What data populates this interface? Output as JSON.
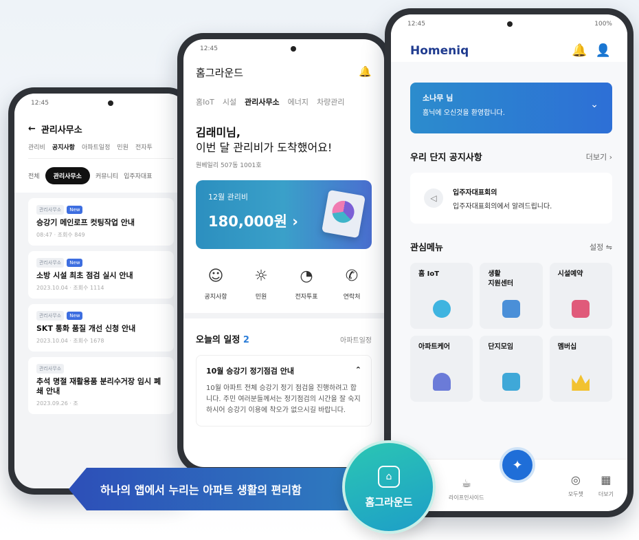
{
  "phone1": {
    "time": "12:45",
    "signal": "",
    "back_icon": "←",
    "title": "관리사무소",
    "tabs": [
      "관리비",
      "공지사항",
      "아파트일정",
      "민원",
      "전자투"
    ],
    "chips": [
      "전체",
      "관리사무소",
      "커뮤니티",
      "입주자대표"
    ],
    "cards": [
      {
        "tag": "관리사무소",
        "new": "New",
        "title": "승강기 메인로프 컷팅작업 안내",
        "meta": "08:47 · 조회수 849"
      },
      {
        "tag": "관리사무소",
        "new": "New",
        "title": "소방 시설 최초 점검 실시 안내",
        "meta": "2023.10.04 · 조회수 1114"
      },
      {
        "tag": "관리사무소",
        "new": "New",
        "title": "SKT 통화 품질 개선 신청 안내",
        "meta": "2023.10.04 · 조회수 1678"
      },
      {
        "tag": "관리사무소",
        "new": "",
        "title": "추석 명절 재활용품 분리수거장 임시 폐쇄 안내",
        "meta": "2023.09.26 · 조"
      }
    ]
  },
  "phone2": {
    "time": "12:45",
    "signal": "",
    "brand": "홈그라운드",
    "tabs": [
      "홈IoT",
      "시설",
      "관리사무소",
      "에너지",
      "차량관리"
    ],
    "greeting_name": "김래미님,",
    "greeting_msg": "이번 달 관리비가 도착했어요!",
    "address": "원베일리 507동 1001호",
    "bill_month": "12월 관리비",
    "bill_amount": "180,000원 ›",
    "quick": [
      {
        "icon": "☺",
        "label": "공지사항"
      },
      {
        "icon": "☼",
        "label": "민원"
      },
      {
        "icon": "◔",
        "label": "전자투표"
      },
      {
        "icon": "✆",
        "label": "연락처"
      }
    ],
    "schedule_title": "오늘의 일정",
    "schedule_count": "2",
    "schedule_link": "아파트일정",
    "schedule_card_title": "10월 승강기 정기점검 안내",
    "schedule_card_chevron": "⌃",
    "schedule_card_body": "10월 아파트 전체 승강기 정기 점검을 진행하려고 합니다. 주민 여러분들께서는 정기점검의 시간을 잘 숙지하시어 승강기 이용에 착오가 없으시길 바랍니다."
  },
  "phone3": {
    "time": "12:45",
    "signal": "100%",
    "logo": "Homeniq",
    "bell_icon": "🔔",
    "user_icon": "👤",
    "welcome_name": "소나무 님",
    "welcome_msg": "홈닉에 오신것을 환영합니다.",
    "notice_section": "우리 단지 공지사항",
    "notice_more": "더보기 ›",
    "notice_title": "입주자대표회의",
    "notice_body": "입주자대표회의에서 알려드립니다.",
    "menu_section": "관심메뉴",
    "menu_settings": "설정 ⇋",
    "tiles": [
      {
        "label": "홈 IoT",
        "color": "#3fb4e0"
      },
      {
        "label": "생활\n지원센터",
        "color": "#4a8fd8"
      },
      {
        "label": "시설예약",
        "color": "#e05a7a"
      },
      {
        "label": "아파트케어",
        "color": "#6b7bd8"
      },
      {
        "label": "단지모임",
        "color": "#3fa8d8"
      },
      {
        "label": "멤버십",
        "color": "#f2c230"
      }
    ],
    "nav": [
      {
        "icon": "☕",
        "label": "라이프인사이드"
      },
      {
        "icon": "◎",
        "label": "모두챗"
      },
      {
        "icon": "▦",
        "label": "더보기"
      }
    ],
    "fab_icon": "✦"
  },
  "banner": {
    "text": "하나의 앱에서 누리는 아파트 생활의 편리함",
    "badge_text": "홈그라운드",
    "badge_icon": "⌂"
  }
}
